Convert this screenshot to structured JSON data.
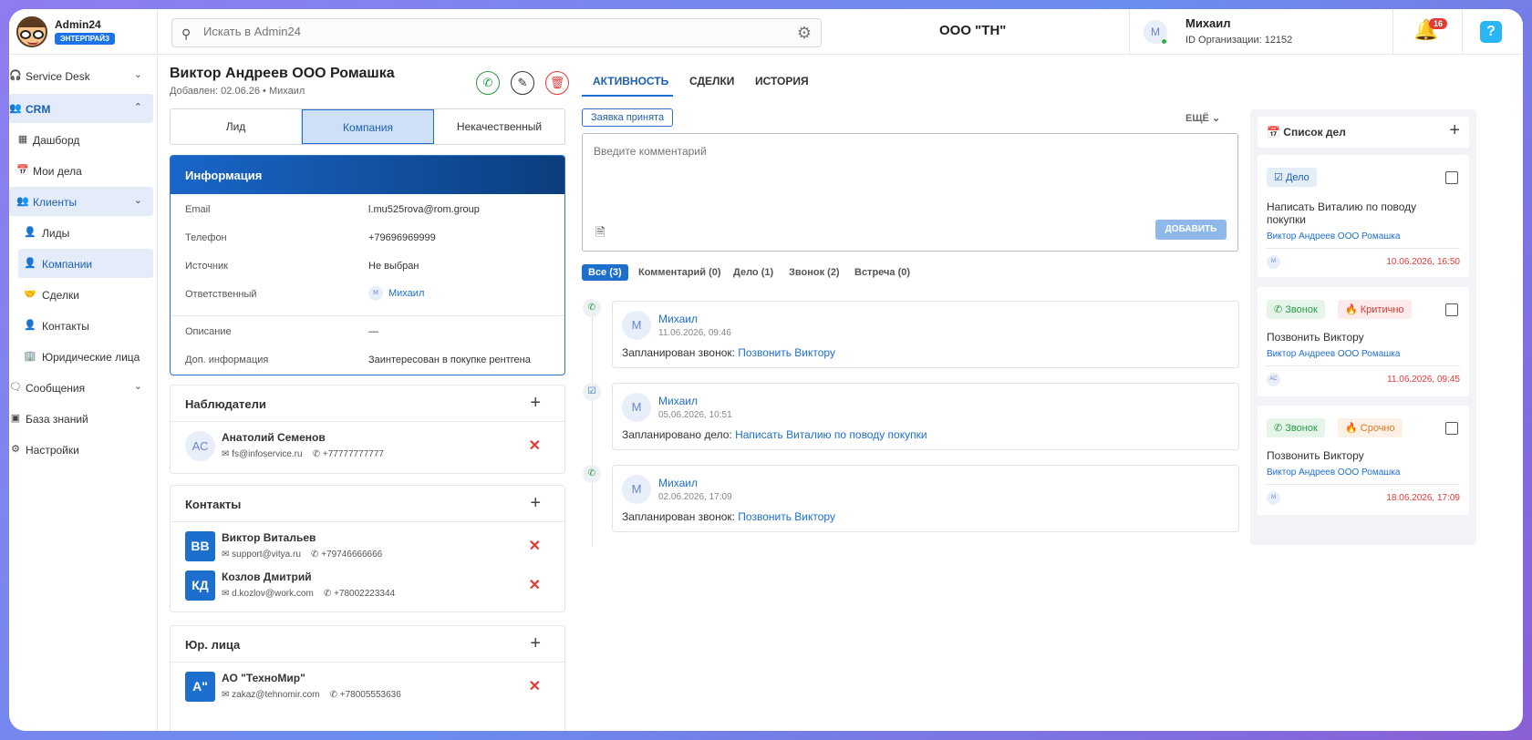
{
  "app": {
    "name": "Admin24",
    "plan": "ЭНТЕРПРАЙЗ",
    "org_title": "ООО \"ТН\""
  },
  "search": {
    "placeholder": "Искать в Admin24"
  },
  "user": {
    "initial": "M",
    "name": "Михаил",
    "org_id": "ID Организации: 12152"
  },
  "notifications": {
    "count": "16"
  },
  "help": {
    "label": "?"
  },
  "sidebar": {
    "items": [
      {
        "label": "Service Desk"
      },
      {
        "label": "CRM"
      },
      {
        "label": "Дашборд"
      },
      {
        "label": "Мои дела"
      },
      {
        "label": "Клиенты"
      },
      {
        "label": "Лиды"
      },
      {
        "label": "Компании"
      },
      {
        "label": "Сделки"
      },
      {
        "label": "Контакты"
      },
      {
        "label": "Юридические лица"
      },
      {
        "label": "Сообщения"
      },
      {
        "label": "База знаний"
      },
      {
        "label": "Настройки"
      }
    ]
  },
  "lead": {
    "title": "Виктор Андреев ООО Ромашка",
    "subtitle": "Добавлен: 02.06.26 • Михаил",
    "segments": [
      "Лид",
      "Компания",
      "Некачественный"
    ],
    "active_segment": "Компания"
  },
  "info": {
    "title": "Информация",
    "rows": [
      {
        "label": "Email",
        "value": "l.mu525rova@rom.group"
      },
      {
        "label": "Телефон",
        "value": "+79696969999"
      },
      {
        "label": "Источник",
        "value": "Не выбран"
      },
      {
        "label": "Ответственный",
        "value": "Михаил",
        "avatar": "M"
      },
      {
        "label": "Описание",
        "value": "—"
      },
      {
        "label": "Доп. информация",
        "value": "Заинтересован в покупке рентгена"
      }
    ]
  },
  "observers": {
    "title": "Наблюдатели",
    "people": [
      {
        "initials": "АС",
        "name": "Анатолий Семенов",
        "email": "fs@infoservice.ru",
        "phone": "+77777777777"
      }
    ]
  },
  "contacts": {
    "title": "Контакты",
    "people": [
      {
        "initials": "ВВ",
        "name": "Виктор Витальев",
        "email": "support@vitya.ru",
        "phone": "+79746666666"
      },
      {
        "initials": "КД",
        "name": "Козлов Дмитрий",
        "email": "d.kozlov@work.com",
        "phone": "+78002223344"
      }
    ]
  },
  "legal": {
    "title": "Юр. лица",
    "people": [
      {
        "initials": "А\"",
        "name": "АО \"ТехноМир\"",
        "email": "zakaz@tehnomir.com",
        "phone": "+78005553636"
      }
    ]
  },
  "tabs": [
    "АКТИВНОСТЬ",
    "СДЕЛКИ",
    "ИСТОРИЯ"
  ],
  "status_chip": "Заявка принята",
  "more_label": "ЕЩЁ",
  "comment": {
    "placeholder": "Введите комментарий",
    "add_label": "ДОБАВИТЬ"
  },
  "filters": [
    "Все (3)",
    "Комментарий (0)",
    "Дело (1)",
    "Звонок (2)",
    "Встреча (0)"
  ],
  "activities": [
    {
      "avatar": "M",
      "author": "Михаил",
      "time": "11.06.2026, 09:46",
      "prefix": "Запланирован звонок: ",
      "link": "Позвонить Виктору",
      "icon": "phone-icon"
    },
    {
      "avatar": "M",
      "author": "Михаил",
      "time": "05.06.2026, 10:51",
      "prefix": "Запланировано дело: ",
      "link": "Написать Виталию по поводу покупки",
      "icon": "task-icon"
    },
    {
      "avatar": "M",
      "author": "Михаил",
      "time": "02.06.2026, 17:09",
      "prefix": "Запланирован звонок: ",
      "link": "Позвонить Виктору",
      "icon": "phone-icon"
    }
  ],
  "todo": {
    "title": "Список дел",
    "cards": [
      {
        "chips": [
          "Дело"
        ],
        "text": "Написать Виталию по поводу покупки",
        "link": "Виктор Андреев ООО Ромашка",
        "avatar": "M",
        "date": "10.06.2026, 16:50"
      },
      {
        "chips": [
          "Звонок",
          "Критично"
        ],
        "text": "Позвонить Виктору",
        "link": "Виктор Андреев ООО Ромашка",
        "avatar": "АС",
        "date": "11.06.2026, 09:45"
      },
      {
        "chips": [
          "Звонок",
          "Срочно"
        ],
        "text": "Позвонить Виктору",
        "link": "Виктор Андреев ООО Ромашка",
        "avatar": "M",
        "date": "18.06.2026, 17:09"
      }
    ]
  },
  "colors": {
    "accent": "#1d6fd1",
    "danger": "#e53935",
    "success": "#2a9a45"
  }
}
